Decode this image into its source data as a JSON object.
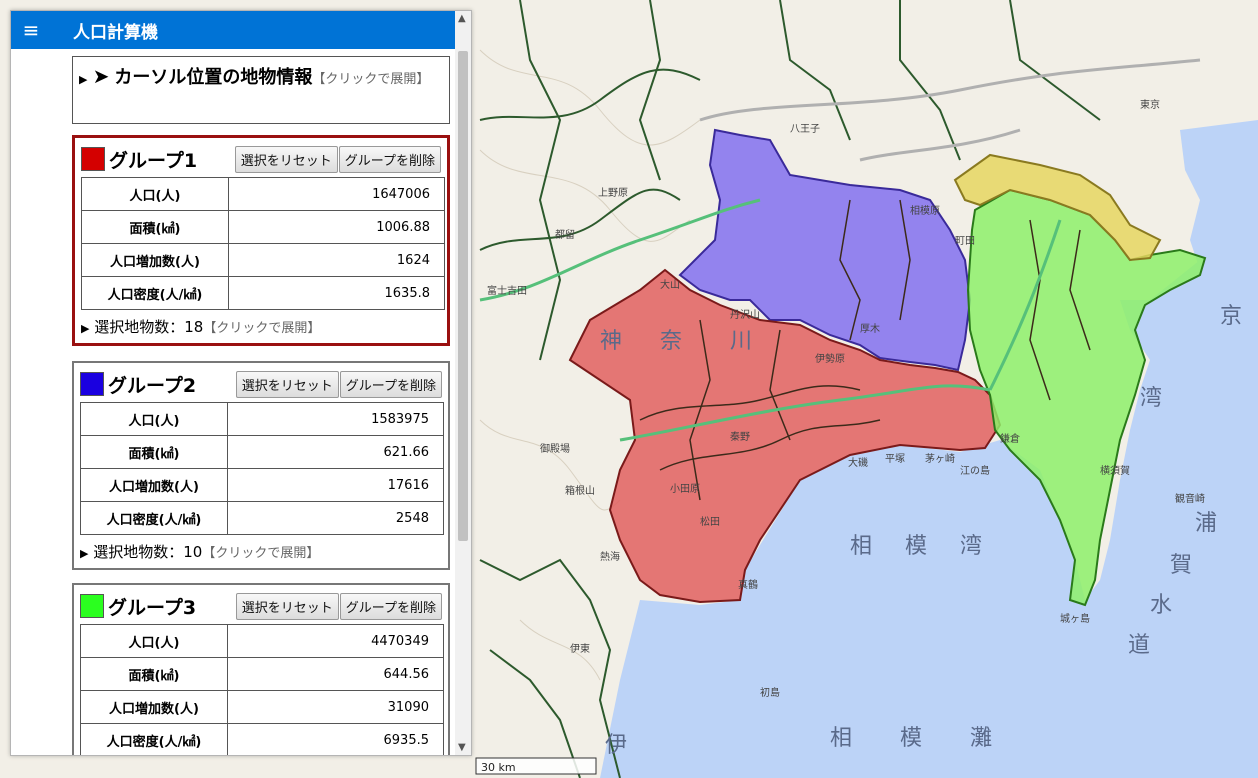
{
  "panel": {
    "title": "人口計算機",
    "cursor_info": {
      "title": "カーソル位置の地物情報",
      "hint": "【クリックで展開】"
    },
    "reset_label": "選択をリセット",
    "delete_label": "グループを削除",
    "stat_labels": {
      "population": "人口(人)",
      "area": "面積(㎢)",
      "increase": "人口増加数(人)",
      "density": "人口密度(人/㎢)"
    },
    "selected_prefix": "選択地物数：",
    "expand_hint": "【クリックで展開】",
    "groups": [
      {
        "name": "グループ1",
        "color": "#d40000",
        "population": "1647006",
        "area": "1006.88",
        "increase": "1624",
        "density": "1635.8",
        "selected": "18"
      },
      {
        "name": "グループ2",
        "color": "#1a00e0",
        "population": "1583975",
        "area": "621.66",
        "increase": "17616",
        "density": "2548",
        "selected": "10"
      },
      {
        "name": "グループ3",
        "color": "#2bff1f",
        "population": "4470349",
        "area": "644.56",
        "increase": "31090",
        "density": "6935.5"
      }
    ]
  },
  "map": {
    "labels": {
      "kanagawa": [
        "神",
        "奈",
        "川"
      ],
      "sagami_bay": [
        "相",
        "模",
        "湾"
      ],
      "sagami_nada": [
        "相",
        "模",
        "灘"
      ],
      "uraga": [
        "浦",
        "賀",
        "水",
        "道"
      ],
      "izu": "伊",
      "tokyo_bay": [
        "湾"
      ],
      "kyo": "京",
      "places": [
        "丹沢山",
        "大山",
        "厚木",
        "伊勢原",
        "小田原",
        "真鶴",
        "江の島",
        "鎌倉",
        "横須賀",
        "観音崎",
        "城ヶ島",
        "富士吉田",
        "都留",
        "上野原",
        "八王子",
        "町田",
        "相模原",
        "東京",
        "大磯",
        "平塚",
        "茅ヶ崎",
        "熱海",
        "伊東",
        "初島",
        "箱根山",
        "御殿場",
        "秦野",
        "松田"
      ]
    },
    "scale": "30 km",
    "colors": {
      "land": "#f2efe7",
      "sea": "#bcd3f7",
      "group1_fill": "#e2605f",
      "group2_fill": "#8370ee",
      "group3_fill": "#8ef06a",
      "yellow_fill": "#e6d660"
    }
  }
}
